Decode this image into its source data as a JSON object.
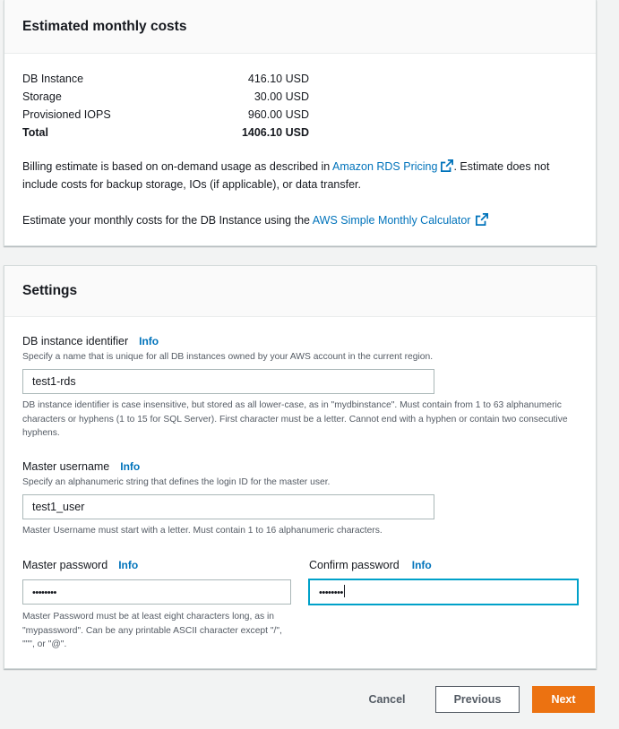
{
  "costs": {
    "title": "Estimated monthly costs",
    "rows": [
      {
        "label": "DB Instance",
        "value": "416.10 USD"
      },
      {
        "label": "Storage",
        "value": "30.00 USD"
      },
      {
        "label": "Provisioned IOPS",
        "value": "960.00 USD"
      }
    ],
    "total": {
      "label": "Total",
      "value": "1406.10 USD"
    },
    "billing_text_1": "Billing estimate is based on on-demand usage as described in ",
    "billing_link": "Amazon RDS Pricing",
    "billing_text_2": ". Estimate does not include costs for backup storage, IOs (if applicable), or data transfer.",
    "calc_text": "Estimate your monthly costs for the DB Instance using the ",
    "calc_link": "AWS Simple Monthly Calculator"
  },
  "settings": {
    "title": "Settings",
    "info_label": "Info",
    "identifier": {
      "label": "DB instance identifier",
      "description": "Specify a name that is unique for all DB instances owned by your AWS account in the current region.",
      "value": "test1-rds",
      "hint": "DB instance identifier is case insensitive, but stored as all lower-case, as in \"mydbinstance\". Must contain from 1 to 63 alphanumeric characters or hyphens (1 to 15 for SQL Server). First character must be a letter. Cannot end with a hyphen or contain two consecutive hyphens."
    },
    "username": {
      "label": "Master username",
      "description": "Specify an alphanumeric string that defines the login ID for the master user.",
      "value": "test1_user",
      "hint": "Master Username must start with a letter. Must contain 1 to 16 alphanumeric characters."
    },
    "password": {
      "label": "Master password",
      "masked_value": "••••••••",
      "hint": "Master Password must be at least eight characters long, as in \"mypassword\". Can be any printable ASCII character except \"/\", \"\"\", or \"@\"."
    },
    "confirm_password": {
      "label": "Confirm password",
      "masked_value": "••••••••"
    }
  },
  "footer": {
    "cancel": "Cancel",
    "previous": "Previous",
    "next": "Next"
  },
  "colors": {
    "link": "#0073bb",
    "primary_button": "#ec7211",
    "focus_border": "#00a1c9"
  }
}
